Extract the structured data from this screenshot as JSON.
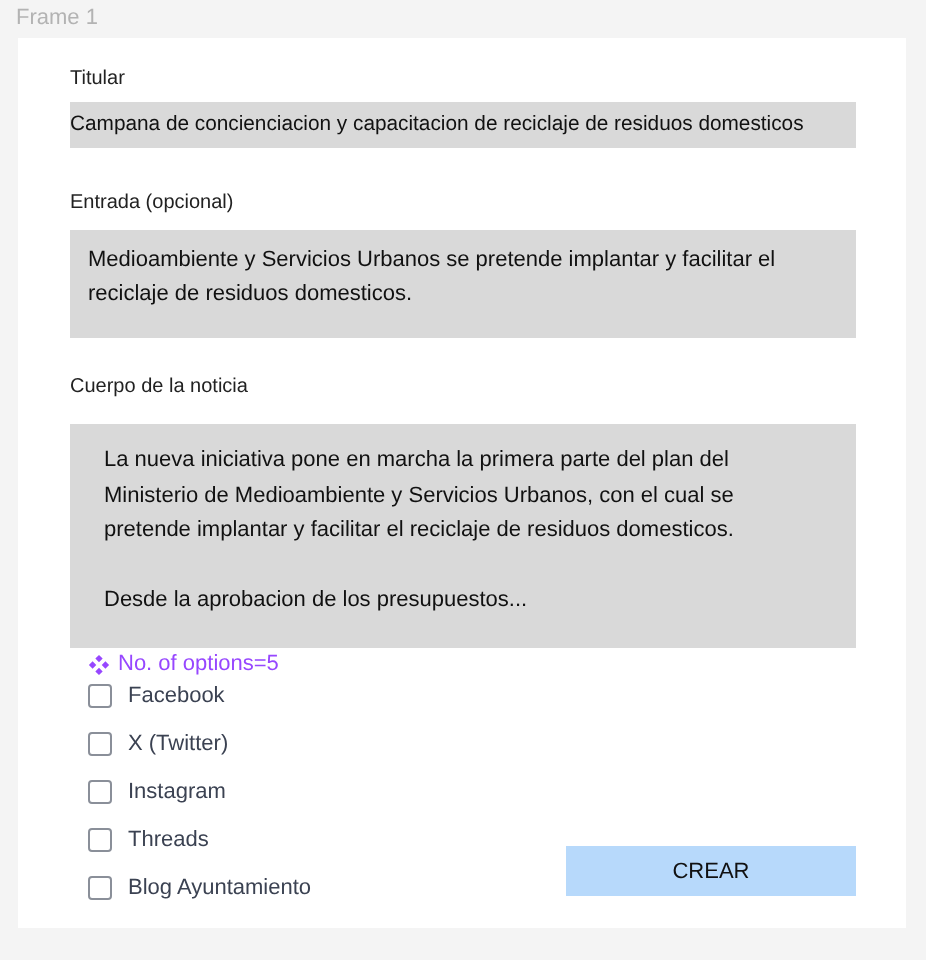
{
  "frame_label": "Frame 1",
  "fields": [
    {
      "kind": "line",
      "label": "Titular",
      "value": "Campana de concienciacion y capacitacion de reciclaje de residuos domesticos"
    },
    {
      "kind": "area",
      "label": "Entrada (opcional)",
      "value": "Medioambiente y Servicios Urbanos se pretende implantar y facilitar el reciclaje de residuos domesticos."
    },
    {
      "kind": "body",
      "label": "Cuerpo de la noticia",
      "paragraphs": [
        "La nueva iniciativa pone en marcha la primera parte del plan del Ministerio de Medioambiente y Servicios Urbanos, con el cual se pretende implantar y facilitar el reciclaje de residuos domesticos.",
        "Desde la aprobacion de los presupuestos..."
      ]
    }
  ],
  "variant_note": "No. of options=5",
  "options": [
    {
      "label": "Facebook",
      "checked": false
    },
    {
      "label": "X (Twitter)",
      "checked": false
    },
    {
      "label": "Instagram",
      "checked": false
    },
    {
      "label": "Threads",
      "checked": false
    },
    {
      "label": "Blog Ayuntamiento",
      "checked": false
    }
  ],
  "submit_button": "CREAR"
}
